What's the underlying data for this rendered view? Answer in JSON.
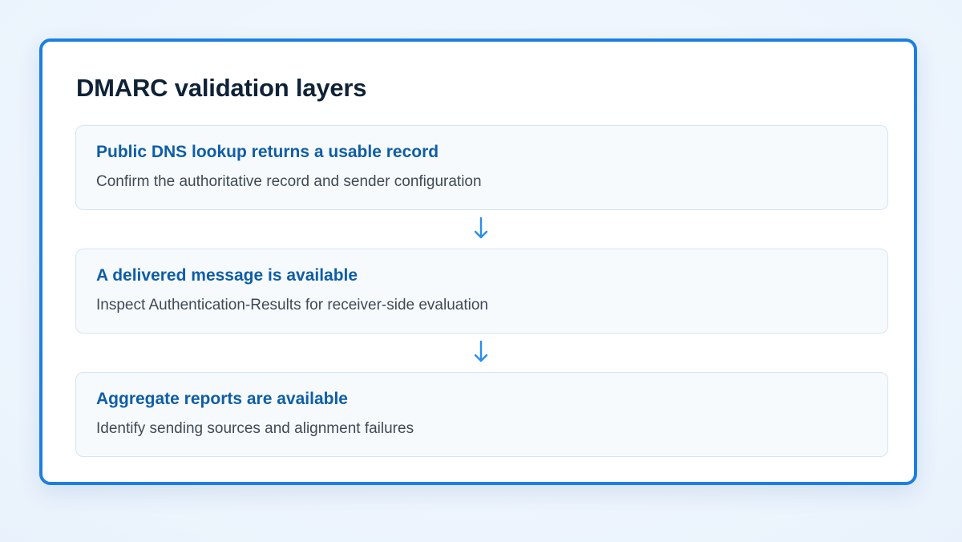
{
  "title": "DMARC validation layers",
  "steps": [
    {
      "title": "Public DNS lookup returns a usable record",
      "description": "Confirm the authoritative record and sender configuration"
    },
    {
      "title": "A delivered message is available",
      "description": "Inspect Authentication-Results for receiver-side evaluation"
    },
    {
      "title": "Aggregate reports are available",
      "description": "Identify sending sources and alignment failures"
    }
  ],
  "colors": {
    "accent": "#1c7fe0",
    "step_title": "#0d5ea8",
    "arrow": "#2b8ee8"
  }
}
